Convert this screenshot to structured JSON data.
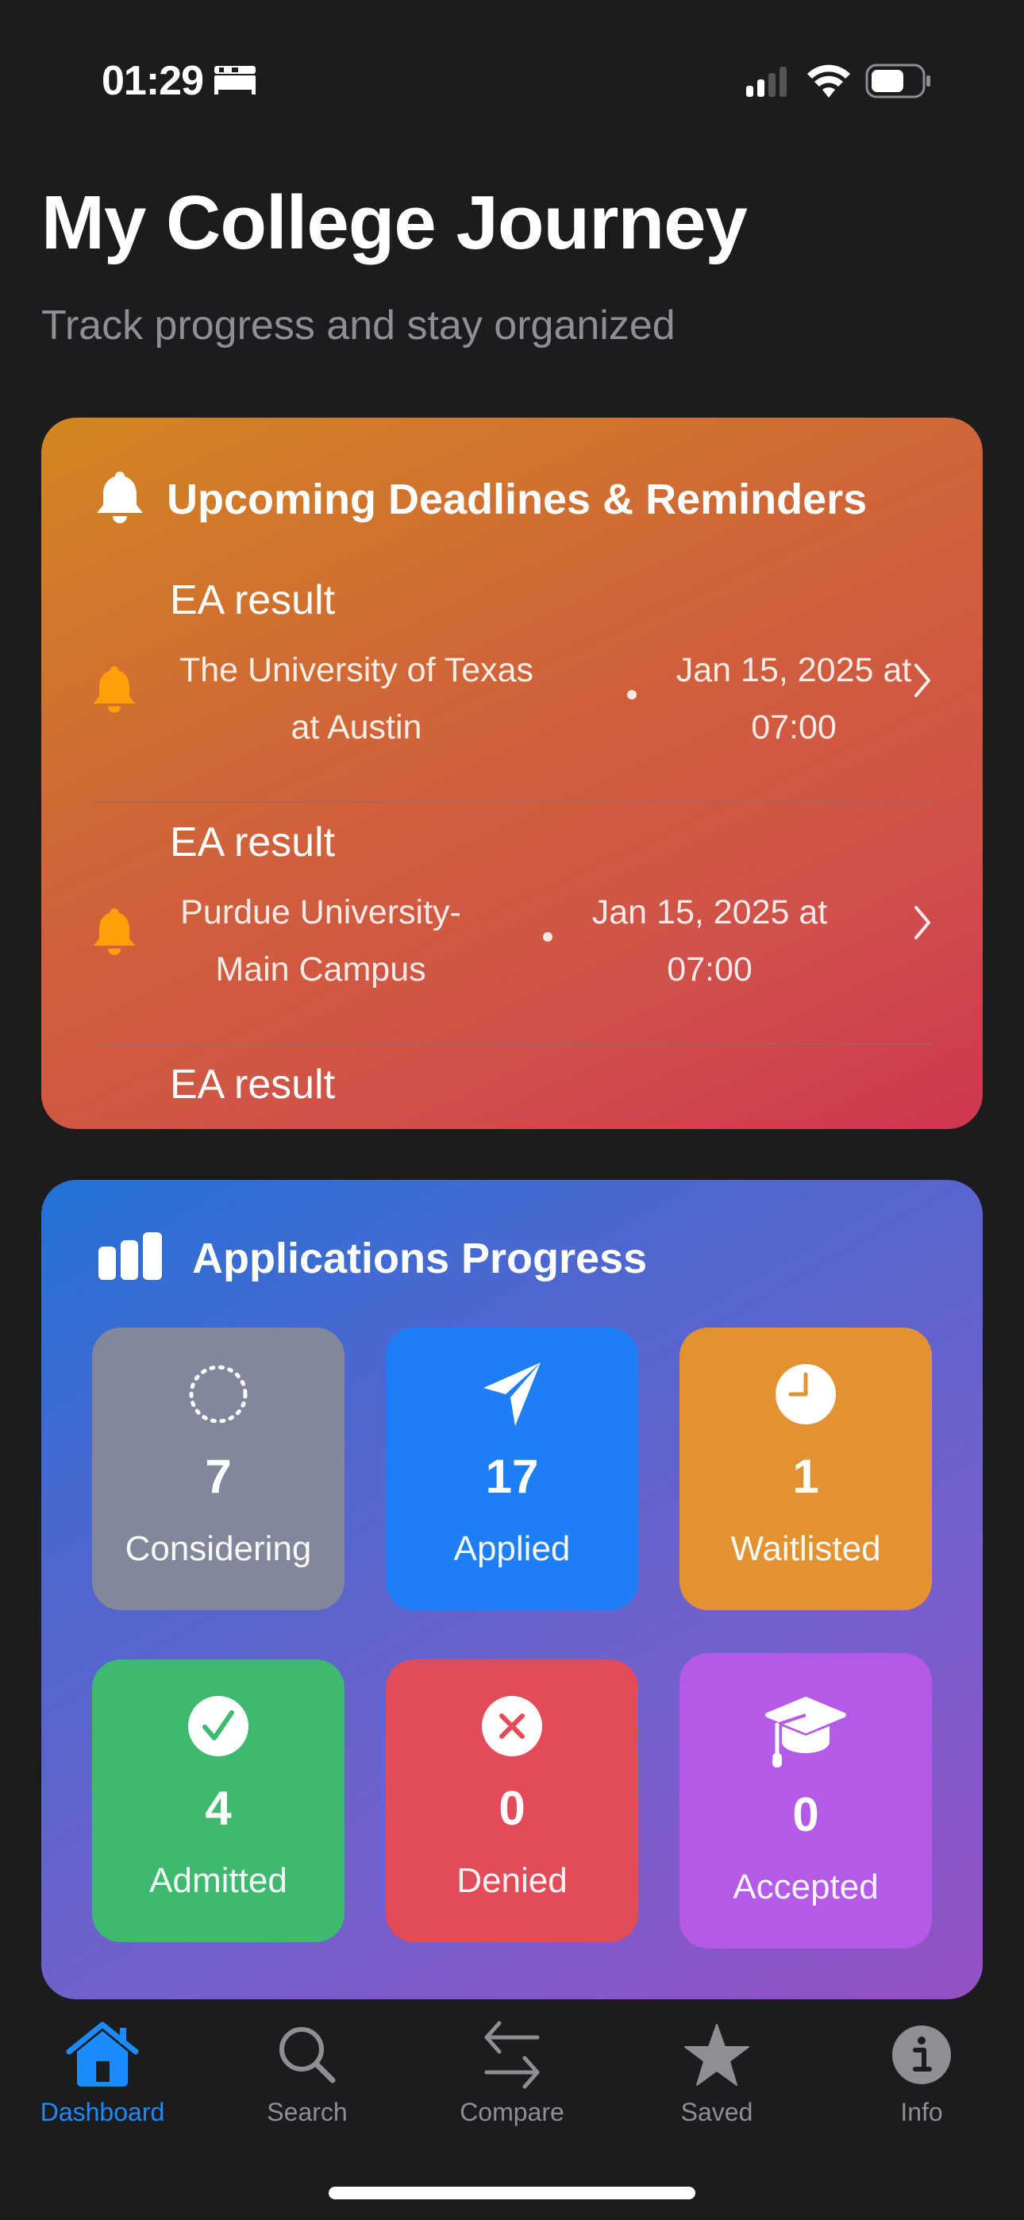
{
  "status_bar": {
    "time": "01:29",
    "focus_icon": "bed-icon",
    "cellular_bars": 2,
    "wifi": "wifi-icon",
    "battery": "battery-icon"
  },
  "header": {
    "title": "My College Journey",
    "subtitle": "Track progress and stay organized"
  },
  "deadlines": {
    "title": "Upcoming Deadlines & Reminders",
    "icon": "bell-icon",
    "items": [
      {
        "title": "EA result",
        "school": "The University of Texas at Austin",
        "date": "Jan 15, 2025 at 07:00"
      },
      {
        "title": "EA result",
        "school": "Purdue University-Main Campus",
        "date": "Jan 15, 2025 at 07:00"
      },
      {
        "title": "EA result",
        "school": "",
        "date": ""
      }
    ]
  },
  "progress": {
    "title": "Applications Progress",
    "icon": "bar-chart-icon",
    "tiles": [
      {
        "label": "Considering",
        "count": "7",
        "icon": "dotted-circle-icon",
        "color": "#82879c"
      },
      {
        "label": "Applied",
        "count": "17",
        "icon": "paper-plane-icon",
        "color": "#1e7ef5"
      },
      {
        "label": "Waitlisted",
        "count": "1",
        "icon": "clock-icon",
        "color": "#e39232"
      },
      {
        "label": "Admitted",
        "count": "4",
        "icon": "checkmark-circle-icon",
        "color": "#3dba6f"
      },
      {
        "label": "Denied",
        "count": "0",
        "icon": "x-circle-icon",
        "color": "#e44b58"
      },
      {
        "label": "Accepted",
        "count": "0",
        "icon": "graduation-cap-icon",
        "color": "#b55ae8"
      }
    ]
  },
  "tab_bar": {
    "active_color": "#1a8cff",
    "inactive_color": "#8e8e93",
    "tabs": [
      {
        "label": "Dashboard",
        "icon": "house-icon",
        "active": true
      },
      {
        "label": "Search",
        "icon": "magnifying-glass-icon",
        "active": false
      },
      {
        "label": "Compare",
        "icon": "arrows-swap-icon",
        "active": false
      },
      {
        "label": "Saved",
        "icon": "star-icon",
        "active": false
      },
      {
        "label": "Info",
        "icon": "info-circle-icon",
        "active": false
      }
    ]
  }
}
